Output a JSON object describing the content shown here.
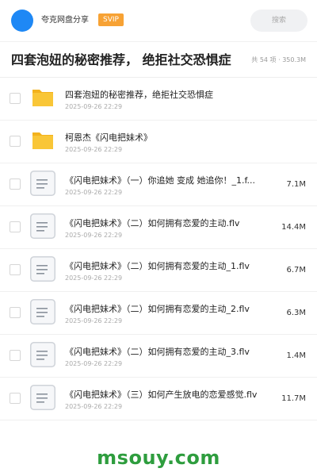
{
  "header": {
    "brand": "夸克网盘分享",
    "badge": "SVIP",
    "search_placeholder": "搜索"
  },
  "title": {
    "text": "四套泡妞的秘密推荐， 绝拒社交恐惧症",
    "meta": "共 54 项 · 350.3M"
  },
  "files": [
    {
      "name": "四套泡妞的秘密推荐，绝拒社交恐惧症",
      "date": "2025-09-26 22:29",
      "size": "",
      "type": "folder"
    },
    {
      "name": "柯恩杰《闪电把妹术》",
      "date": "2025-09-26 22:29",
      "size": "",
      "type": "folder"
    },
    {
      "name": "《闪电把妹术》（一）你追她 变成 她追你！_1.f...",
      "date": "2025-09-26 22:29",
      "size": "7.1M",
      "type": "file"
    },
    {
      "name": "《闪电把妹术》（二）如何拥有恋爱的主动.flv",
      "date": "2025-09-26 22:29",
      "size": "14.4M",
      "type": "file"
    },
    {
      "name": "《闪电把妹术》（二）如何拥有恋爱的主动_1.flv",
      "date": "2025-09-26 22:29",
      "size": "6.7M",
      "type": "file"
    },
    {
      "name": "《闪电把妹术》（二）如何拥有恋爱的主动_2.flv",
      "date": "2025-09-26 22:29",
      "size": "6.3M",
      "type": "file"
    },
    {
      "name": "《闪电把妹术》（二）如何拥有恋爱的主动_3.flv",
      "date": "2025-09-26 22:29",
      "size": "1.4M",
      "type": "file"
    },
    {
      "name": "《闪电把妹术》（三）如何产生放电的恋爱感觉.flv",
      "date": "2025-09-26 22:29",
      "size": "11.7M",
      "type": "file"
    }
  ],
  "icons": {
    "folder": "folder-icon",
    "file": "document-icon"
  },
  "colors": {
    "folder": "#f9c637",
    "folder_tab": "#f3b21d",
    "accent": "#1e88f5",
    "badge": "#f7a234",
    "watermark": "#2e9d3e"
  },
  "watermark": "msouy.com"
}
